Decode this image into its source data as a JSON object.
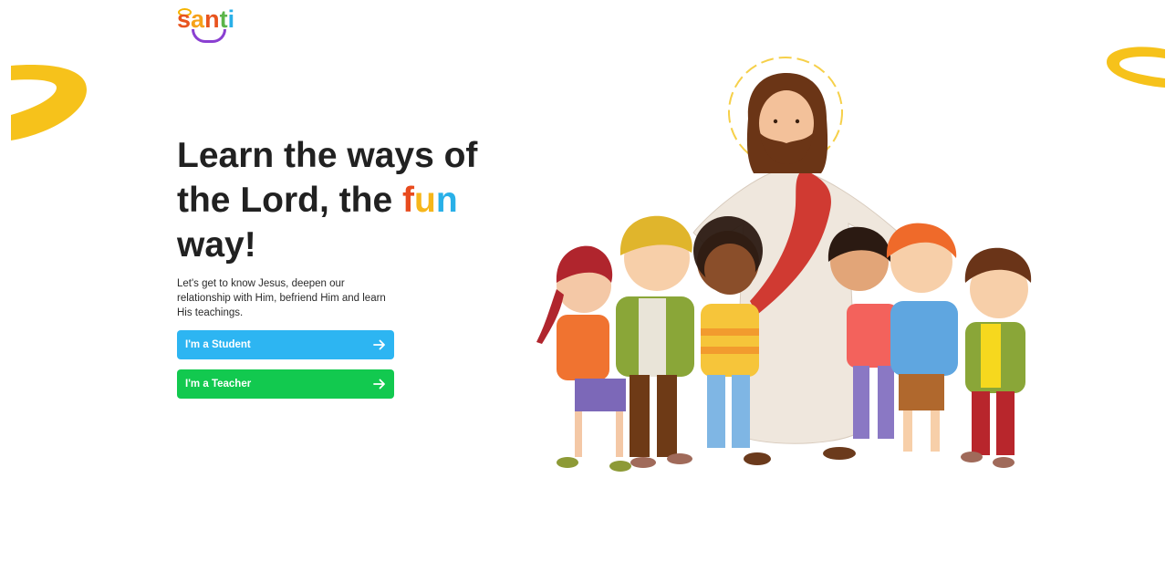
{
  "brand": {
    "logo_letters": [
      "s",
      "a",
      "n",
      "t",
      "i"
    ],
    "logo_colors": [
      "#e8541e",
      "#f6a21b",
      "#e8541e",
      "#5bb54a",
      "#29b0e8"
    ],
    "accent_yellow": "#f6c21b"
  },
  "hero": {
    "headline_part1": "Learn the ways of the Lord, the ",
    "headline_fun": [
      "f",
      "u",
      "n"
    ],
    "headline_part2": " way!",
    "subtitle": "Let's get to know Jesus, deepen our relationship with Him, befriend Him and learn His teachings."
  },
  "buttons": {
    "student_label": "I'm a Student",
    "student_color": "#2db5f2",
    "teacher_label": "I'm a Teacher",
    "teacher_color": "#12c94f",
    "arrow_icon": "arrow-right-icon"
  },
  "illustration": {
    "subject": "jesus-with-children-illustration"
  }
}
